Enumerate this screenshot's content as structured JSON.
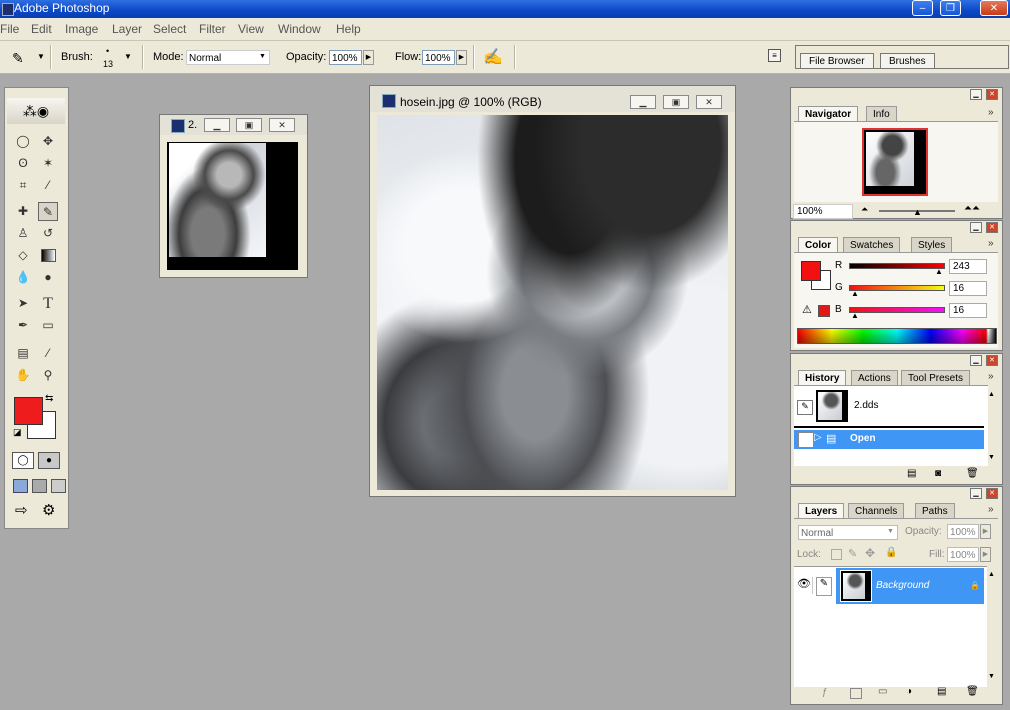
{
  "app": {
    "title": "Adobe Photoshop",
    "window_buttons": {
      "minimize": "–",
      "restore": "❐",
      "close": "✕"
    }
  },
  "menu": [
    "File",
    "Edit",
    "Image",
    "Layer",
    "Select",
    "Filter",
    "View",
    "Window",
    "Help"
  ],
  "options": {
    "brush_label": "Brush:",
    "brush_size": "13",
    "mode_label": "Mode:",
    "mode_value": "Normal",
    "opacity_label": "Opacity:",
    "opacity_value": "100%",
    "flow_label": "Flow:",
    "flow_value": "100%",
    "well_tabs": [
      "File Browser",
      "Brushes"
    ]
  },
  "toolbox": {
    "tools": [
      "marquee",
      "move",
      "lasso",
      "magic-wand",
      "crop",
      "slice",
      "healing",
      "brush",
      "stamp",
      "history-brush",
      "eraser",
      "gradient",
      "blur",
      "dodge",
      "path-select",
      "type",
      "pen",
      "shape",
      "notes",
      "eyedropper",
      "hand",
      "zoom"
    ],
    "foreground_color": "#ee1c1c",
    "background_color": "#ffffff"
  },
  "doc_small": {
    "title": "2.",
    "icon": "photoshop-doc-icon"
  },
  "doc_main": {
    "title": "hosein.jpg @ 100% (RGB)",
    "icon": "photoshop-doc-icon"
  },
  "navigator": {
    "tabs": [
      "Navigator",
      "Info"
    ],
    "zoom": "100%"
  },
  "color": {
    "tabs": [
      "Color",
      "Swatches",
      "Styles"
    ],
    "r_label": "R",
    "g_label": "G",
    "b_label": "B",
    "r": "243",
    "g": "16",
    "b": "16",
    "foreground": "#f31010"
  },
  "history": {
    "tabs": [
      "History",
      "Actions",
      "Tool Presets"
    ],
    "snapshot": "2.dds",
    "step": "Open"
  },
  "layers": {
    "tabs": [
      "Layers",
      "Channels",
      "Paths"
    ],
    "blend": "Normal",
    "opacity_label": "Opacity:",
    "opacity": "100%",
    "lock_label": "Lock:",
    "fill_label": "Fill:",
    "fill": "100%",
    "layer_name": "Background"
  }
}
